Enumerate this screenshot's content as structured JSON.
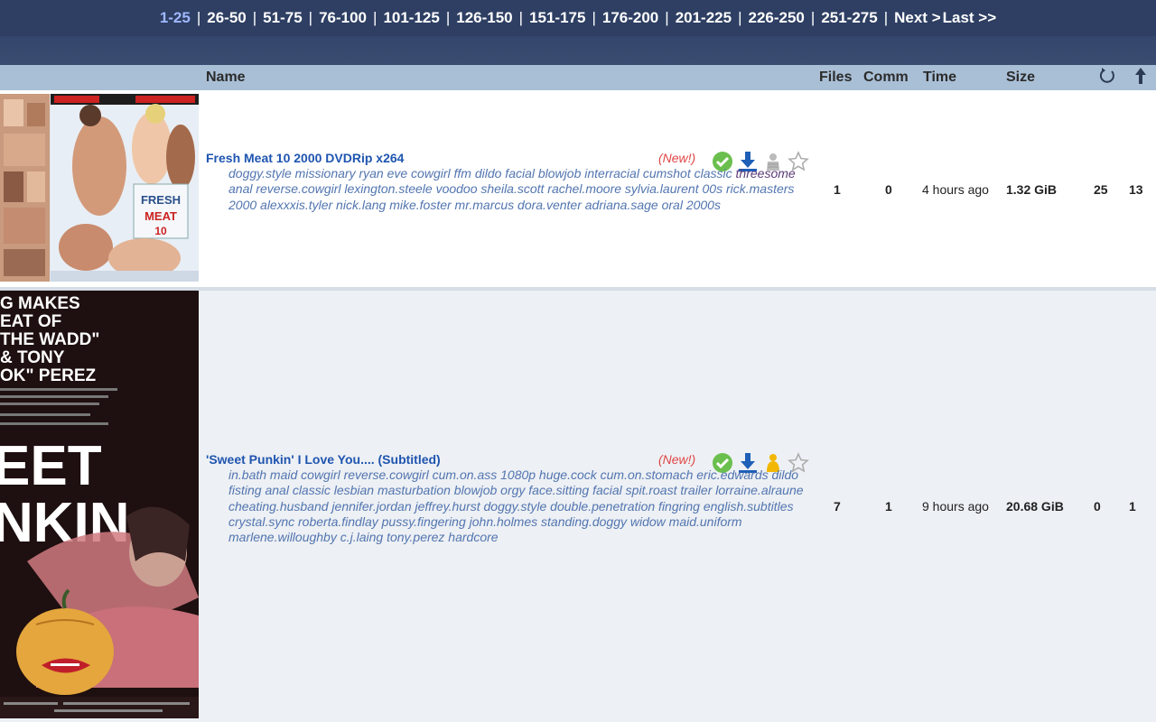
{
  "pagination": {
    "pages": [
      "1-25",
      "26-50",
      "51-75",
      "76-100",
      "101-125",
      "126-150",
      "151-175",
      "176-200",
      "201-225",
      "226-250",
      "251-275"
    ],
    "current": "1-25",
    "next": "Next >",
    "last": "Last >>",
    "separator": "|"
  },
  "table": {
    "headers": {
      "name": "Name",
      "files": "Files",
      "comm": "Comm",
      "time": "Time",
      "size": "Size"
    },
    "refresh_icon": "refresh-icon",
    "upload_icon": "arrow-up-icon"
  },
  "rows": [
    {
      "title": "Fresh Meat 10 2000 DVDRip x264",
      "new": "(New!)",
      "tags_before": "doggy.style missionary ryan eve cowgirl ffm dildo facial blowjob interracial cumshot classic ",
      "tag_highlight": "threesome",
      "tags_after": " anal reverse.cowgirl lexington.steele voodoo sheila.scott rachel.moore sylvia.laurent 00s rick.masters 2000 alexxxis.tyler nick.lang mike.foster mr.marcus dora.venter adriana.sage oral 2000s",
      "files": "1",
      "comm": "0",
      "time": "4 hours ago",
      "size": "1.32 GiB",
      "seeders": "25",
      "leechers": "13",
      "cover_text": "FRESH MEAT 10"
    },
    {
      "title": "'Sweet Punkin' I Love You.... (Subtitled)",
      "new": "(New!)",
      "tags": "in.bath maid cowgirl reverse.cowgirl cum.on.ass 1080p huge.cock cum.on.stomach eric.edwards dildo fisting anal classic lesbian masturbation blowjob orgy face.sitting facial spit.roast trailer lorraine.alraune cheating.husband jennifer.jordan jeffrey.hurst doggy.style double.penetration fingring english.subtitles crystal.sync roberta.findlay pussy.fingering john.holmes standing.doggy widow maid.uniform marlene.willoughby c.j.laing tony.perez hardcore",
      "files": "7",
      "comm": "1",
      "time": "9 hours ago",
      "size": "20.68 GiB",
      "seeders": "0",
      "leechers": "1",
      "poster_lines": [
        "G MAKES",
        "EAT OF",
        "THE WADD\"",
        "& TONY",
        "OK\" PEREZ"
      ],
      "poster_title": [
        "EET",
        "NKIN"
      ]
    }
  ],
  "colors": {
    "header_bg": "#2e3f63",
    "table_header_bg": "#a9bfd6",
    "title_link": "#1f55b0",
    "new_tag": "#e04646",
    "tags": "#5275b0"
  }
}
